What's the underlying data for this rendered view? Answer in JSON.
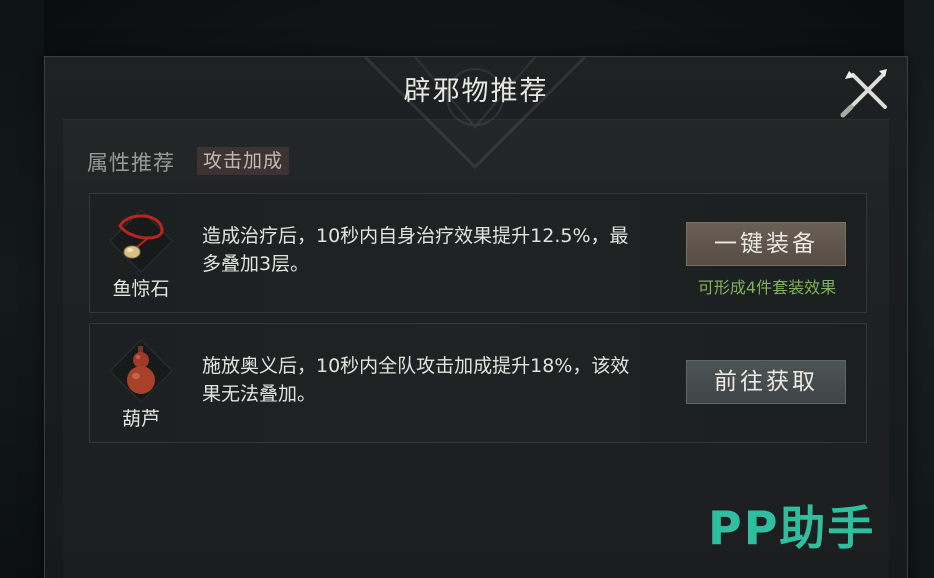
{
  "dialog": {
    "title": "辟邪物推荐",
    "close_icon": "crossed-swords-close-icon"
  },
  "attribute": {
    "label": "属性推荐",
    "tag": "攻击加成"
  },
  "items": [
    {
      "name": "鱼惊石",
      "icon": "red-cord-pendant-icon",
      "description": "造成治疗后，10秒内自身治疗效果提升12.5%，最多叠加3层。",
      "button": "一键装备",
      "hint": "可形成4件套装效果"
    },
    {
      "name": "葫芦",
      "icon": "gourd-icon",
      "description": "施放奥义后，10秒内全队攻击加成提升18%，该效果无法叠加。",
      "button": "前往获取"
    }
  ],
  "watermark": "PP助手",
  "colors": {
    "equip_button": "#5f554c",
    "acquire_button": "#474d4f",
    "hint_green": "#7fb15a",
    "watermark_teal": "#2fbf9f"
  }
}
